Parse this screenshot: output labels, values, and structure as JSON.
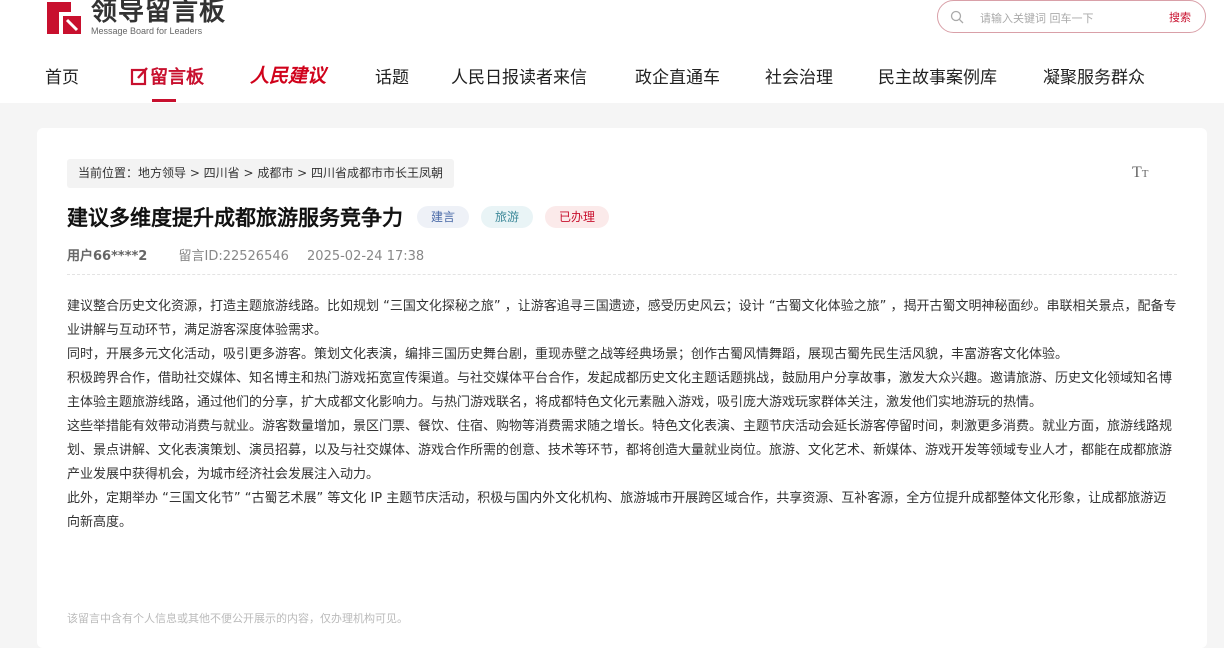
{
  "site": {
    "logo_cn": "领导留言板",
    "logo_en": "Message Board for Leaders"
  },
  "search": {
    "placeholder": "请输入关键词 回车一下",
    "button": "搜索"
  },
  "nav": {
    "home": "首页",
    "board": "留言板",
    "people_suggest": "人民建议",
    "topics": "话题",
    "readers_letters": "人民日报读者来信",
    "gov_direct": "政企直通车",
    "social_gov": "社会治理",
    "democracy_cases": "民主故事案例库",
    "service_group": "凝聚服务群众"
  },
  "breadcrumb": "当前位置：地方领导 > 四川省 > 成都市 > 四川省成都市市长王凤朝",
  "font_toggle": {
    "big": "T",
    "small": "T"
  },
  "message": {
    "title": "建议多维度提升成都旅游服务竞争力",
    "tags": [
      "建言",
      "旅游",
      "已办理"
    ],
    "user": "用户66****2",
    "message_id": "留言ID:22526546",
    "date": "2025-02-24 17:38",
    "paragraphs": [
      "建议整合历史文化资源，打造主题旅游线路。比如规划 “三国文化探秘之旅” ，让游客追寻三国遗迹，感受历史风云；设计 “古蜀文化体验之旅” ，揭开古蜀文明神秘面纱。串联相关景点，配备专业讲解与互动环节，满足游客深度体验需求。",
      "同时，开展多元文化活动，吸引更多游客。策划文化表演，编排三国历史舞台剧，重现赤壁之战等经典场景；创作古蜀风情舞蹈，展现古蜀先民生活风貌，丰富游客文化体验。",
      "积极跨界合作，借助社交媒体、知名博主和热门游戏拓宽宣传渠道。与社交媒体平台合作，发起成都历史文化主题话题挑战，鼓励用户分享故事，激发大众兴趣。邀请旅游、历史文化领域知名博主体验主题旅游线路，通过他们的分享，扩大成都文化影响力。与热门游戏联名，将成都特色文化元素融入游戏，吸引庞大游戏玩家群体关注，激发他们实地游玩的热情。",
      "这些举措能有效带动消费与就业。游客数量增加，景区门票、餐饮、住宿、购物等消费需求随之增长。特色文化表演、主题节庆活动会延长游客停留时间，刺激更多消费。就业方面，旅游线路规划、景点讲解、文化表演策划、演员招募，以及与社交媒体、游戏合作所需的创意、技术等环节，都将创造大量就业岗位。旅游、文化艺术、新媒体、游戏开发等领域专业人才，都能在成都旅游产业发展中获得机会，为城市经济社会发展注入动力。",
      "此外，定期举办 “三国文化节” “古蜀艺术展” 等文化 IP 主题节庆活动，积极与国内外文化机构、旅游城市开展跨区域合作，共享资源、互补客源，全方位提升成都整体文化形象，让成都旅游迈向新高度。"
    ],
    "privacy_notice": "该留言中含有个人信息或其他不便公开展示的内容，仅办理机构可见。"
  },
  "colors": {
    "brand_red": "#c8102e",
    "tag_blue_text": "#4a6aa8",
    "tag_teal_text": "#3f8a9a"
  }
}
